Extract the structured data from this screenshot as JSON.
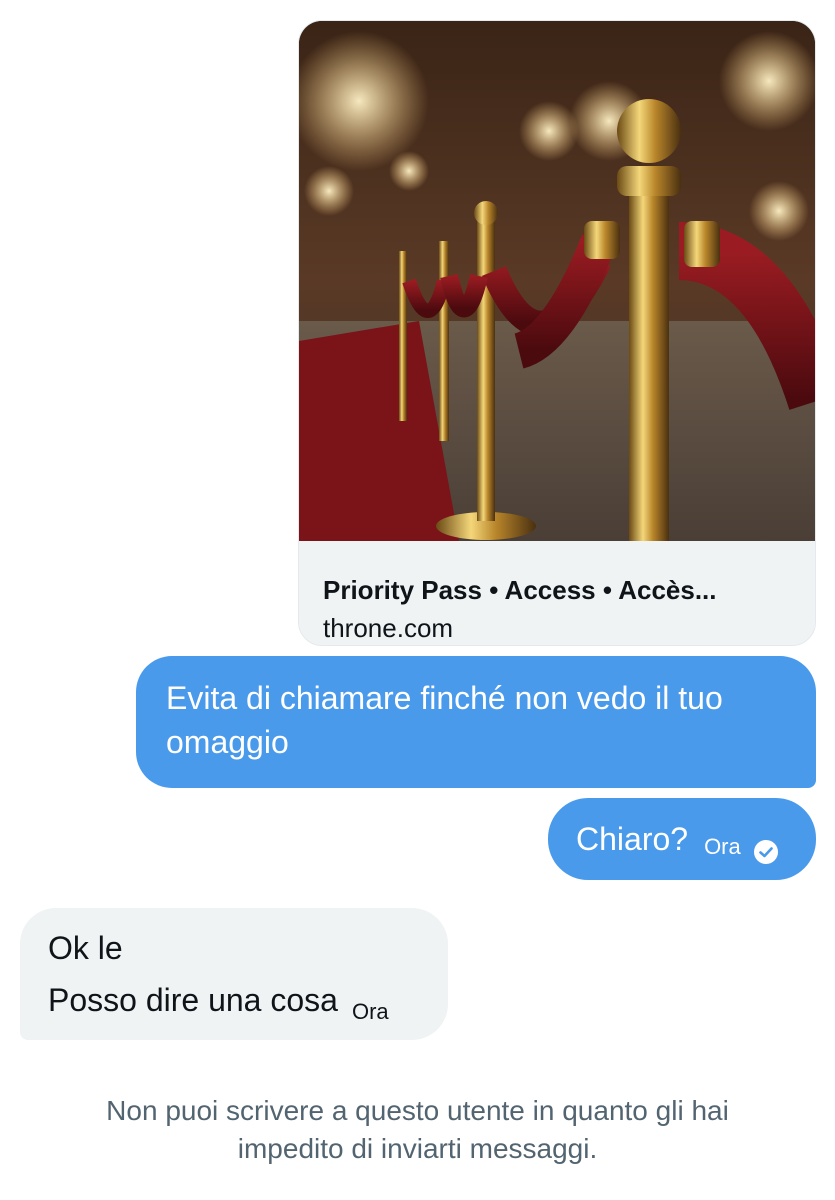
{
  "link_card": {
    "title": "Priority Pass • Access • Accès...",
    "domain": "throne.com",
    "image_description_icon": "velvet-rope-photo"
  },
  "messages": [
    {
      "direction": "outgoing",
      "text": "Evita di chiamare finché non vedo il tuo omaggio"
    },
    {
      "direction": "outgoing",
      "text": "Chiaro?",
      "time": "Ora",
      "status_icon": "check-circle-icon"
    },
    {
      "direction": "incoming",
      "lines": [
        "Ok le",
        "Posso dire una cosa"
      ],
      "time": "Ora"
    }
  ],
  "notice": {
    "line1": "Non puoi scrivere a questo utente in quanto gli hai",
    "line2": "impedito di inviarti messaggi."
  },
  "colors": {
    "outgoing_bubble": "#4a9aec",
    "incoming_bubble": "#eff3f4",
    "notice_text": "#536471"
  }
}
